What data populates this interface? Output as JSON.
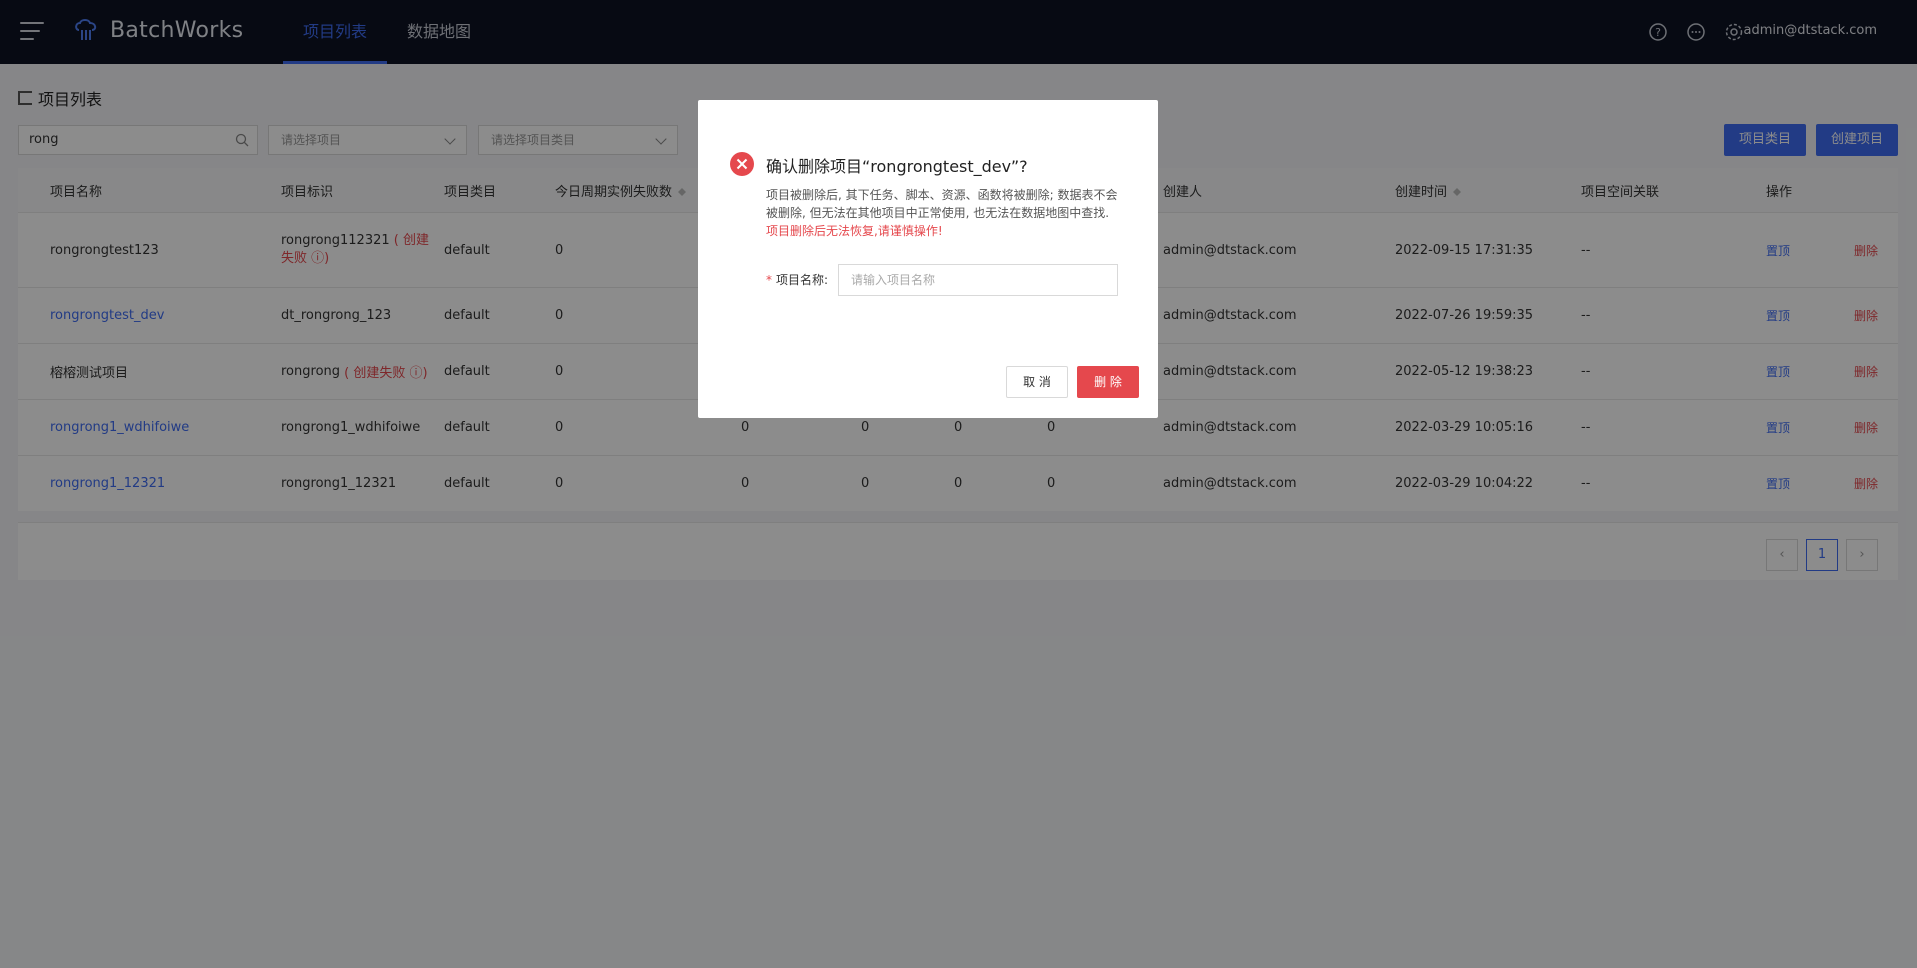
{
  "app": {
    "name": "BatchWorks"
  },
  "nav": {
    "tabs": [
      {
        "label": "项目列表",
        "active": true
      },
      {
        "label": "数据地图",
        "active": false
      }
    ],
    "user_email": "admin@dtstack.com"
  },
  "page": {
    "title": "项目列表",
    "search_value": "rong",
    "select_project_placeholder": "请选择项目",
    "select_category_placeholder": "请选择项目类目",
    "btn_category": "项目类目",
    "btn_create": "创建项目"
  },
  "table": {
    "headers": {
      "name": "项目名称",
      "identifier": "项目标识",
      "category": "项目类目",
      "fail_count": "今日周期实例失败数",
      "creator": "创建人",
      "created_at": "创建时间",
      "space_link": "项目空间关联",
      "actions": "操作"
    },
    "rows": [
      {
        "name": "rongrongtest123",
        "name_link": false,
        "identifier": "rongrong112321",
        "status": "( 创建失败 ⓘ)",
        "category": "default",
        "fail": "0",
        "c2": "",
        "c3": "",
        "c4": "",
        "c5": "",
        "creator": "admin@dtstack.com",
        "created_at": "2022-09-15 17:31:35",
        "space": "--"
      },
      {
        "name": "rongrongtest_dev",
        "name_link": true,
        "identifier": "dt_rongrong_123",
        "status": "",
        "category": "default",
        "fail": "0",
        "c2": "",
        "c3": "",
        "c4": "",
        "c5": "",
        "creator": "admin@dtstack.com",
        "created_at": "2022-07-26 19:59:35",
        "space": "--"
      },
      {
        "name": "榕榕测试项目",
        "name_link": false,
        "identifier": "rongrong",
        "status": "( 创建失败 ⓘ)",
        "category": "default",
        "fail": "0",
        "c2": "",
        "c3": "",
        "c4": "",
        "c5": "",
        "creator": "admin@dtstack.com",
        "created_at": "2022-05-12 19:38:23",
        "space": "--"
      },
      {
        "name": "rongrong1_wdhifoiwe",
        "name_link": true,
        "identifier": "rongrong1_wdhifoiwe",
        "status": "",
        "category": "default",
        "fail": "0",
        "c2": "0",
        "c3": "0",
        "c4": "0",
        "c5": "0",
        "creator": "admin@dtstack.com",
        "created_at": "2022-03-29 10:05:16",
        "space": "--"
      },
      {
        "name": "rongrong1_12321",
        "name_link": true,
        "identifier": "rongrong1_12321",
        "status": "",
        "category": "default",
        "fail": "0",
        "c2": "0",
        "c3": "0",
        "c4": "0",
        "c5": "0",
        "creator": "admin@dtstack.com",
        "created_at": "2022-03-29 10:04:22",
        "space": "--"
      }
    ],
    "action_pin": "置顶",
    "action_delete": "删除"
  },
  "pagination": {
    "current": "1"
  },
  "modal": {
    "title": "确认删除项目“rongrongtest_dev”?",
    "desc": "项目被删除后, 其下任务、脚本、资源、函数将被删除; 数据表不会被删除, 但无法在其他项目中正常使用, 也无法在数据地图中查找.",
    "warning": "项目删除后无法恢复,请谨慎操作!",
    "field_label": "项目名称:",
    "field_placeholder": "请输入项目名称",
    "cancel_label": "取 消",
    "delete_label": "删 除"
  }
}
